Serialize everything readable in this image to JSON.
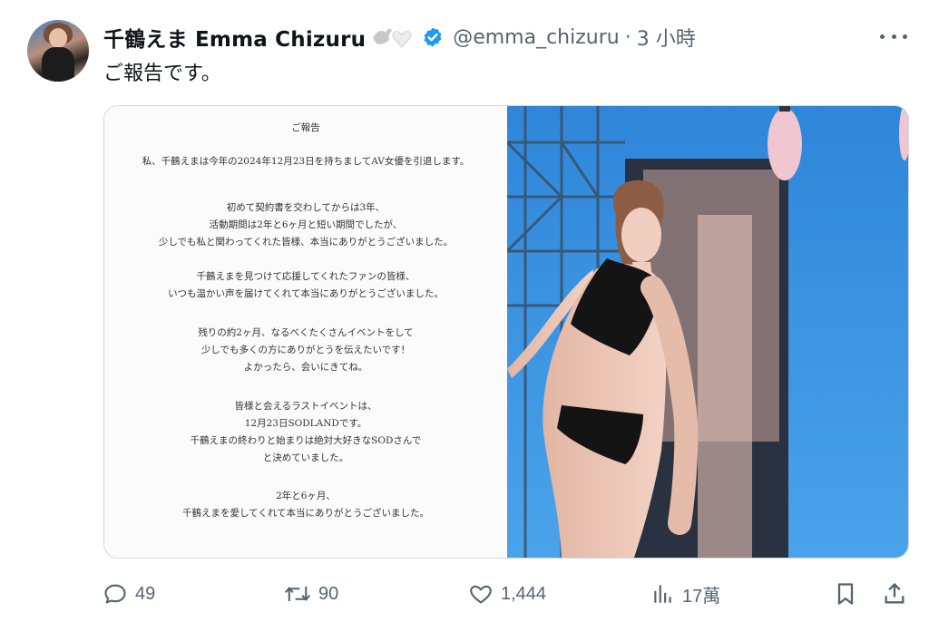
{
  "author": {
    "display_name": "千鶴えま Emma Chizuru",
    "handle": "@emma_chizuru",
    "separator": "·",
    "time": "3 小時"
  },
  "tweet": {
    "text": "ご報告です。"
  },
  "document": {
    "title": "ご報告",
    "lines": [
      "私、千鶴えまは今年の2024年12月23日を持ちましてAV女優を引退します。",
      "初めて契約書を交わしてからは3年、",
      "活動期間は2年と6ヶ月と短い期間でしたが、",
      "少しでも私と関わってくれた皆様、本当にありがとうございました。",
      "千鶴えまを見つけて応援してくれたファンの皆様、",
      "いつも温かい声を届けてくれて本当にありがとうございました。",
      "残りの約2ヶ月、なるべくたくさんイベントをして",
      "少しでも多くの方にありがとうを伝えたいです！",
      "よかったら、会いにきてね。",
      "皆様と会えるラストイベントは、",
      "12月23日SODLANDです。",
      "千鶴えまの終わりと始まりは絶対大好きなSODさんで",
      "と決めていました。",
      "2年と6ヶ月、",
      "千鶴えまを愛してくれて本当にありがとうございました。"
    ]
  },
  "actions": {
    "replies": "49",
    "retweets": "90",
    "likes": "1,444",
    "views": "17萬"
  },
  "colors": {
    "text_primary": "#0f1419",
    "text_secondary": "#536471",
    "verified": "#1d9bf0",
    "border": "#cfd9de"
  },
  "icons": {
    "reply": "speech-bubble-icon",
    "retweet": "retweet-arrows-icon",
    "like": "heart-outline-icon",
    "views": "bar-chart-icon",
    "bookmark": "bookmark-icon",
    "share": "share-upload-icon",
    "more": "more-dots-icon"
  }
}
